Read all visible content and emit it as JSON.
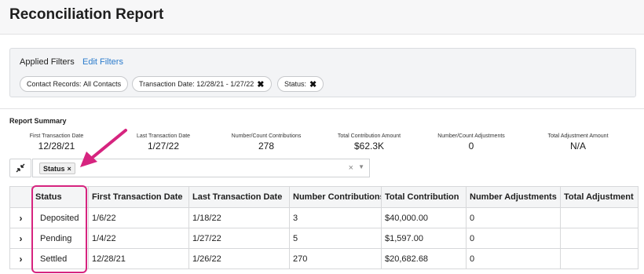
{
  "page": {
    "title": "Reconciliation Report"
  },
  "filters": {
    "applied_label": "Applied Filters",
    "edit_label": "Edit Filters",
    "chips": [
      {
        "label": "Contact Records:",
        "value": "All Contacts"
      },
      {
        "label": "Transaction Date:",
        "value": "12/28/21 - 1/27/22",
        "close": "✖"
      },
      {
        "label": "Status:",
        "value": "",
        "close": "✖"
      }
    ]
  },
  "summary": {
    "title": "Report Summary",
    "stats": [
      {
        "label": "First Transaction Date",
        "value": "12/28/21"
      },
      {
        "label": "Last Transaction Date",
        "value": "1/27/22"
      },
      {
        "label": "Number/Count Contributions",
        "value": "278"
      },
      {
        "label": "Total Contribution Amount",
        "value": "$62.3K"
      },
      {
        "label": "Number/Count Adjustments",
        "value": "0"
      },
      {
        "label": "Total Adjustment Amount",
        "value": "N/A"
      }
    ]
  },
  "grouping": {
    "chip_label": "Status",
    "chip_close": "×",
    "clear": "×",
    "caret": "▼"
  },
  "table": {
    "columns": [
      "",
      "Status",
      "First Transaction Date",
      "Last Transaction Date",
      "Number Contributions",
      "Total Contribution",
      "Number Adjustments",
      "Total Adjustment"
    ],
    "rows": [
      {
        "expander": "›",
        "status": "Deposited",
        "first": "1/6/22",
        "last": "1/18/22",
        "num_contrib": "3",
        "total_contrib": "$40,000.00",
        "num_adj": "0",
        "total_adj": ""
      },
      {
        "expander": "›",
        "status": "Pending",
        "first": "1/4/22",
        "last": "1/27/22",
        "num_contrib": "5",
        "total_contrib": "$1,597.00",
        "num_adj": "0",
        "total_adj": ""
      },
      {
        "expander": "›",
        "status": "Settled",
        "first": "12/28/21",
        "last": "1/26/22",
        "num_contrib": "270",
        "total_contrib": "$20,682.68",
        "num_adj": "0",
        "total_adj": ""
      }
    ]
  },
  "annotation_color": "#d6247f"
}
